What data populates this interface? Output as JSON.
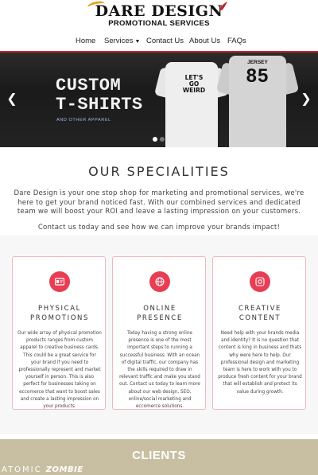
{
  "brand": {
    "name": "Dare Design",
    "tagline": "PROMOTIONAL SERVICES",
    "accent_color": "#e73e55",
    "swoosh_color": "#e2a21e"
  },
  "nav": {
    "items": [
      {
        "label": "Home"
      },
      {
        "label": "Services",
        "icon": "chevron-down-icon"
      },
      {
        "label": "Contact Us"
      },
      {
        "label": "About Us"
      },
      {
        "label": "FAQs"
      }
    ]
  },
  "hero": {
    "title_line1": "CUSTOM",
    "title_line2": "T-SHIRTS",
    "subtitle": "AND OTHER APPAREL",
    "shirt_white_text": "LET'S GO WEIRD",
    "shirt_grey_label": "JERSEY",
    "shirt_grey_number": "85",
    "prev_icon": "chevron-left-icon",
    "next_icon": "chevron-right-icon",
    "slide_count": 2,
    "active_slide": 1
  },
  "specialities": {
    "title": "OUR SPECIALITIES",
    "intro": "Dare Design is your one stop shop for marketing and promotional services, we're here to get your brand noticed fast. With our combined services and dedicated team we will boost your ROI and leave a lasting impression on your customers.",
    "cta": "Contact us today and see how we can improve your brands impact!",
    "cards": [
      {
        "icon": "id-card-icon",
        "title_line1": "PHYSICAL",
        "title_line2": "PROMOTIONS",
        "text": "Our wide array of physical promotion products ranges from custom apparel to creative business cards. This could be a great service for your brand if you need to professionally represent and market yourself in person. This is also perfect for businesses taking on eccomerce that want to boost sales and create a lasting impression on your products."
      },
      {
        "icon": "globe-icon",
        "title_line1": "ONLINE",
        "title_line2": "PRESENCE",
        "text": "Today having a strong online presence is one of the most important steps to running a successful business. With an ocean of digital traffic, our company has the skills required to draw in relevant traffic and make you stand out. Contact us today to learn more about our web design, SEO, online/social marketing and eccomerce solutions."
      },
      {
        "icon": "instagram-icon",
        "title_line1": "CREATIVE",
        "title_line2": "CONTENT",
        "text": "Need help with your brands media and identity? It is no question that content is king in business and thats why were here to help. Our professional design and marketing team is here to work with you to produce fresh content for your brand that will establish and protect its value during growth."
      }
    ]
  },
  "clients": {
    "title": "CLIENTS",
    "logo_word1": "ATOMIC",
    "logo_word2": "ZOMBIE"
  }
}
